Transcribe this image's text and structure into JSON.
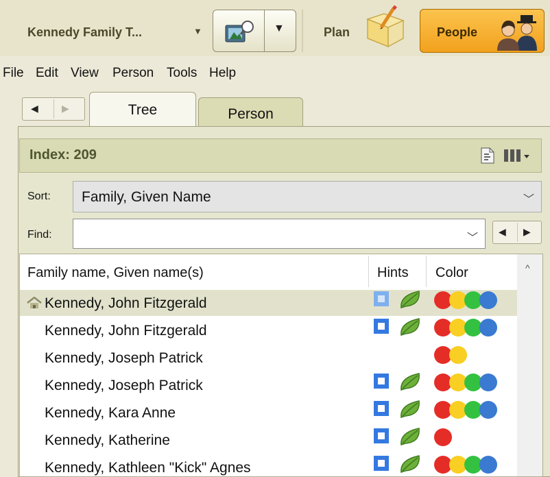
{
  "toolbar": {
    "tree_title": "Kennedy Family T...",
    "plan_label": "Plan",
    "people_label": "People"
  },
  "menu": [
    "File",
    "Edit",
    "View",
    "Person",
    "Tools",
    "Help"
  ],
  "tabs": {
    "tree": "Tree",
    "person": "Person"
  },
  "index": {
    "label": "Index: 209"
  },
  "sort": {
    "label": "Sort:",
    "value": "Family, Given Name"
  },
  "find": {
    "label": "Find:",
    "value": ""
  },
  "columns": {
    "name": "Family name, Given name(s)",
    "hints": "Hints",
    "color": "Color"
  },
  "colors": {
    "red": "#e52d27",
    "yellow": "#f8cf22",
    "green": "#34c141",
    "blue": "#3a7ad1",
    "accent": "#f2a11d"
  },
  "rows": [
    {
      "name": "Kennedy, John Fitzgerald",
      "home": true,
      "selected": true,
      "hints": true,
      "colors": [
        "red",
        "yellow",
        "green",
        "blue"
      ]
    },
    {
      "name": "Kennedy, John Fitzgerald",
      "home": false,
      "selected": false,
      "hints": true,
      "colors": [
        "red",
        "yellow",
        "green",
        "blue"
      ]
    },
    {
      "name": "Kennedy, Joseph Patrick",
      "home": false,
      "selected": false,
      "hints": false,
      "colors": [
        "red",
        "yellow"
      ]
    },
    {
      "name": "Kennedy, Joseph Patrick",
      "home": false,
      "selected": false,
      "hints": true,
      "colors": [
        "red",
        "yellow",
        "green",
        "blue"
      ]
    },
    {
      "name": "Kennedy, Kara Anne",
      "home": false,
      "selected": false,
      "hints": true,
      "colors": [
        "red",
        "yellow",
        "green",
        "blue"
      ]
    },
    {
      "name": "Kennedy, Katherine",
      "home": false,
      "selected": false,
      "hints": true,
      "colors": [
        "red"
      ]
    },
    {
      "name": "Kennedy, Kathleen \"Kick\" Agnes",
      "home": false,
      "selected": false,
      "hints": true,
      "colors": [
        "red",
        "yellow",
        "green",
        "blue"
      ]
    }
  ]
}
